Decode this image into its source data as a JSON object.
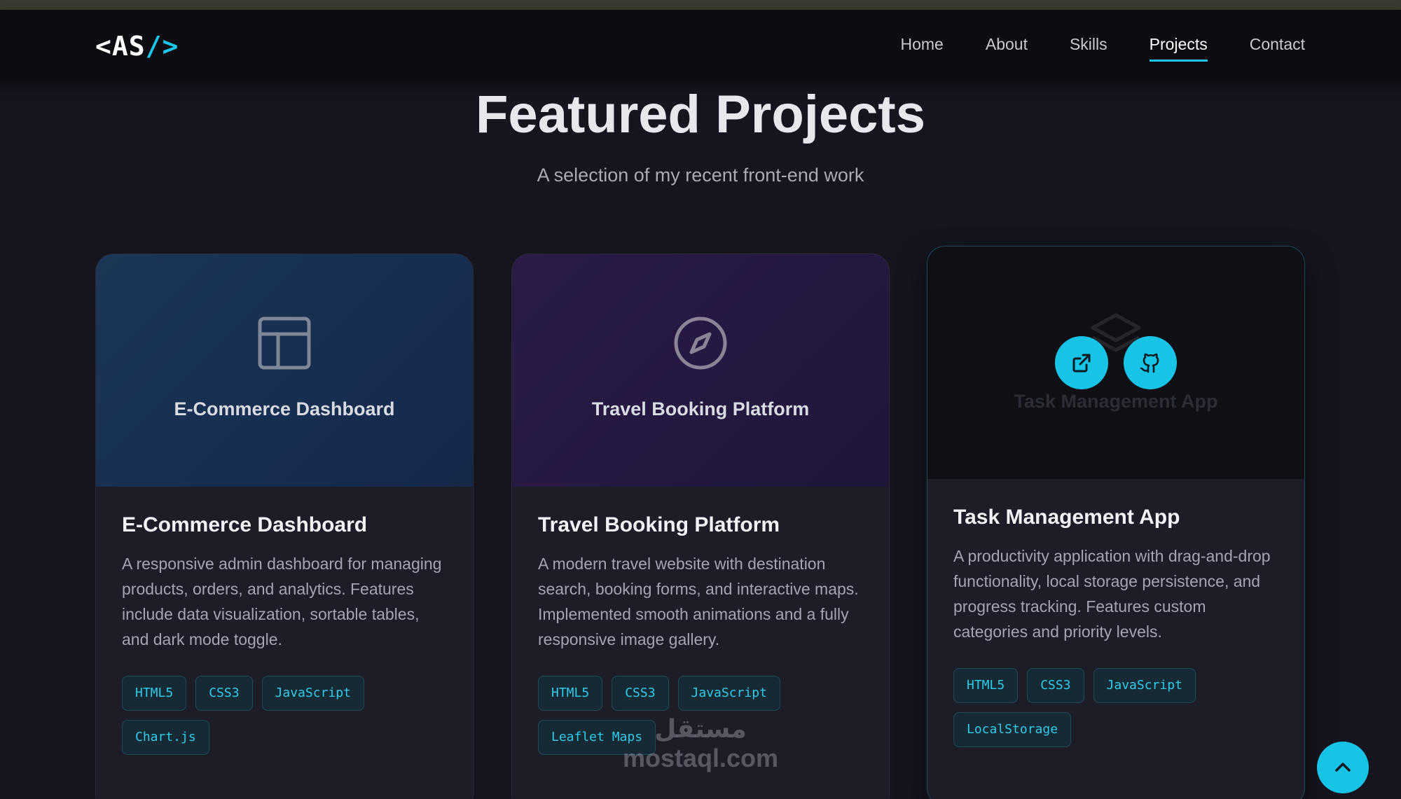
{
  "logo": {
    "open": "<AS",
    "slash": "/>"
  },
  "nav": {
    "items": [
      {
        "label": "Home"
      },
      {
        "label": "About"
      },
      {
        "label": "Skills"
      },
      {
        "label": "Projects",
        "active": true
      },
      {
        "label": "Contact"
      }
    ]
  },
  "section": {
    "title": "Featured Projects",
    "subtitle": "A selection of my recent front-end work"
  },
  "projects": [
    {
      "media_title": "E-Commerce Dashboard",
      "media_icon": "layout-icon",
      "title": "E-Commerce Dashboard",
      "description": "A responsive admin dashboard for managing products, orders, and analytics. Features include data visualization, sortable tables, and dark mode toggle.",
      "tags": [
        "HTML5",
        "CSS3",
        "JavaScript",
        "Chart.js"
      ]
    },
    {
      "media_title": "Travel Booking Platform",
      "media_icon": "compass-icon",
      "title": "Travel Booking Platform",
      "description": "A modern travel website with destination search, booking forms, and interactive maps. Implemented smooth animations and a fully responsive image gallery.",
      "tags": [
        "HTML5",
        "CSS3",
        "JavaScript",
        "Leaflet Maps"
      ]
    },
    {
      "media_title": "Task Management App",
      "media_icon": "layers-icon",
      "title": "Task Management App",
      "description": "A productivity application with drag-and-drop functionality, local storage persistence, and progress tracking. Features custom categories and priority levels.",
      "tags": [
        "HTML5",
        "CSS3",
        "JavaScript",
        "LocalStorage"
      ],
      "hover_actions": [
        "external-link-icon",
        "github-icon"
      ]
    }
  ],
  "watermark": {
    "arabic": "مستقل",
    "latin": "mostaql.com"
  },
  "colors": {
    "accent": "#1bc6e8",
    "background": "#15151f",
    "card": "#1d1d28"
  }
}
